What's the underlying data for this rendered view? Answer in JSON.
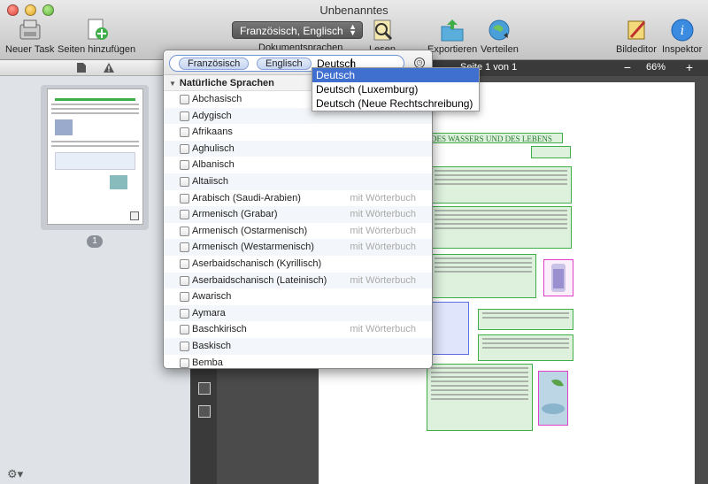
{
  "window": {
    "title": "Unbenanntes"
  },
  "toolbar": {
    "new_task": "Neuer Task",
    "add_pages": "Seiten hinzufügen",
    "language_selected": "Französisch, Englisch",
    "language_caption": "Dokumentsprachen",
    "read": "Lesen",
    "export": "Exportieren",
    "share": "Verteilen",
    "image_editor": "Bildeditor",
    "inspector": "Inspektor"
  },
  "sidebar": {
    "thumbnail_number": "1"
  },
  "document": {
    "page_indicator": "Seite 1 von 1",
    "zoom": "66%",
    "heading": "DES WASSERS UND DES LEBENS"
  },
  "language_popover": {
    "tokens": [
      "Französisch",
      "Englisch"
    ],
    "typed_text": "Deutsch",
    "section_title": "Natürliche Sprachen",
    "dictionary_label": "mit Wörterbuch",
    "languages": [
      {
        "name": "Abchasisch",
        "dict": false
      },
      {
        "name": "Adygisch",
        "dict": false
      },
      {
        "name": "Afrikaans",
        "dict": false
      },
      {
        "name": "Aghulisch",
        "dict": false
      },
      {
        "name": "Albanisch",
        "dict": false
      },
      {
        "name": "Altaiisch",
        "dict": false
      },
      {
        "name": "Arabisch (Saudi-Arabien)",
        "dict": true
      },
      {
        "name": "Armenisch (Grabar)",
        "dict": true
      },
      {
        "name": "Armenisch (Ostarmenisch)",
        "dict": true
      },
      {
        "name": "Armenisch (Westarmenisch)",
        "dict": true
      },
      {
        "name": "Aserbaidschanisch (Kyrillisch)",
        "dict": false
      },
      {
        "name": "Aserbaidschanisch (Lateinisch)",
        "dict": true
      },
      {
        "name": "Awarisch",
        "dict": false
      },
      {
        "name": "Aymara",
        "dict": false
      },
      {
        "name": "Baschkirisch",
        "dict": true
      },
      {
        "name": "Baskisch",
        "dict": false
      },
      {
        "name": "Bemba",
        "dict": false
      }
    ]
  },
  "autocomplete": {
    "items": [
      "Deutsch",
      "Deutsch (Luxemburg)",
      "Deutsch (Neue Rechtschreibung)"
    ],
    "selected_index": 0
  },
  "colors": {
    "accent": "#3f6fcf",
    "zone_green": "#3fae49",
    "zone_pink": "#e040c8",
    "zone_blue": "#5a6fe0"
  }
}
